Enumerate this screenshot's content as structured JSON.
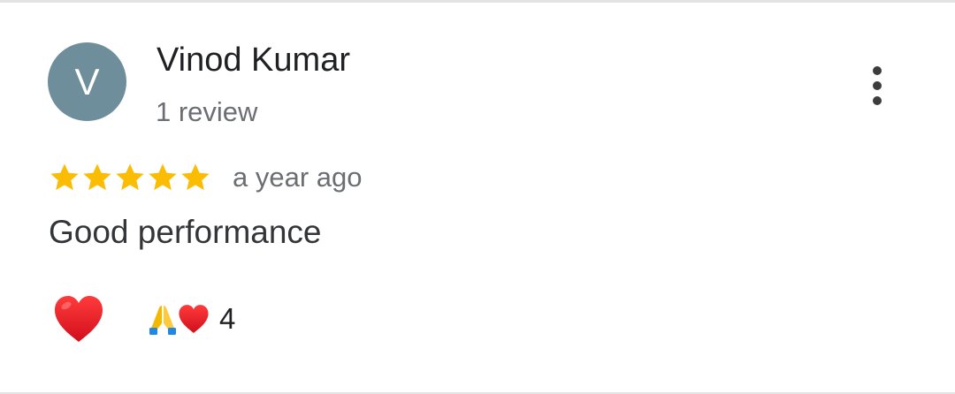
{
  "review": {
    "author": {
      "initial": "V",
      "name": "Vinod Kumar",
      "review_count": "1 review",
      "avatar_color": "#6f8e9b"
    },
    "rating": {
      "stars": 5,
      "max_stars": 5,
      "star_color": "#fbbc04"
    },
    "time": "a year ago",
    "text": "Good performance",
    "reactions": {
      "like_icon": "heart-icon",
      "summary_icons": [
        "folded-hands-icon",
        "heart-icon"
      ],
      "count": "4"
    },
    "menu_icon": "more-vert-icon"
  }
}
